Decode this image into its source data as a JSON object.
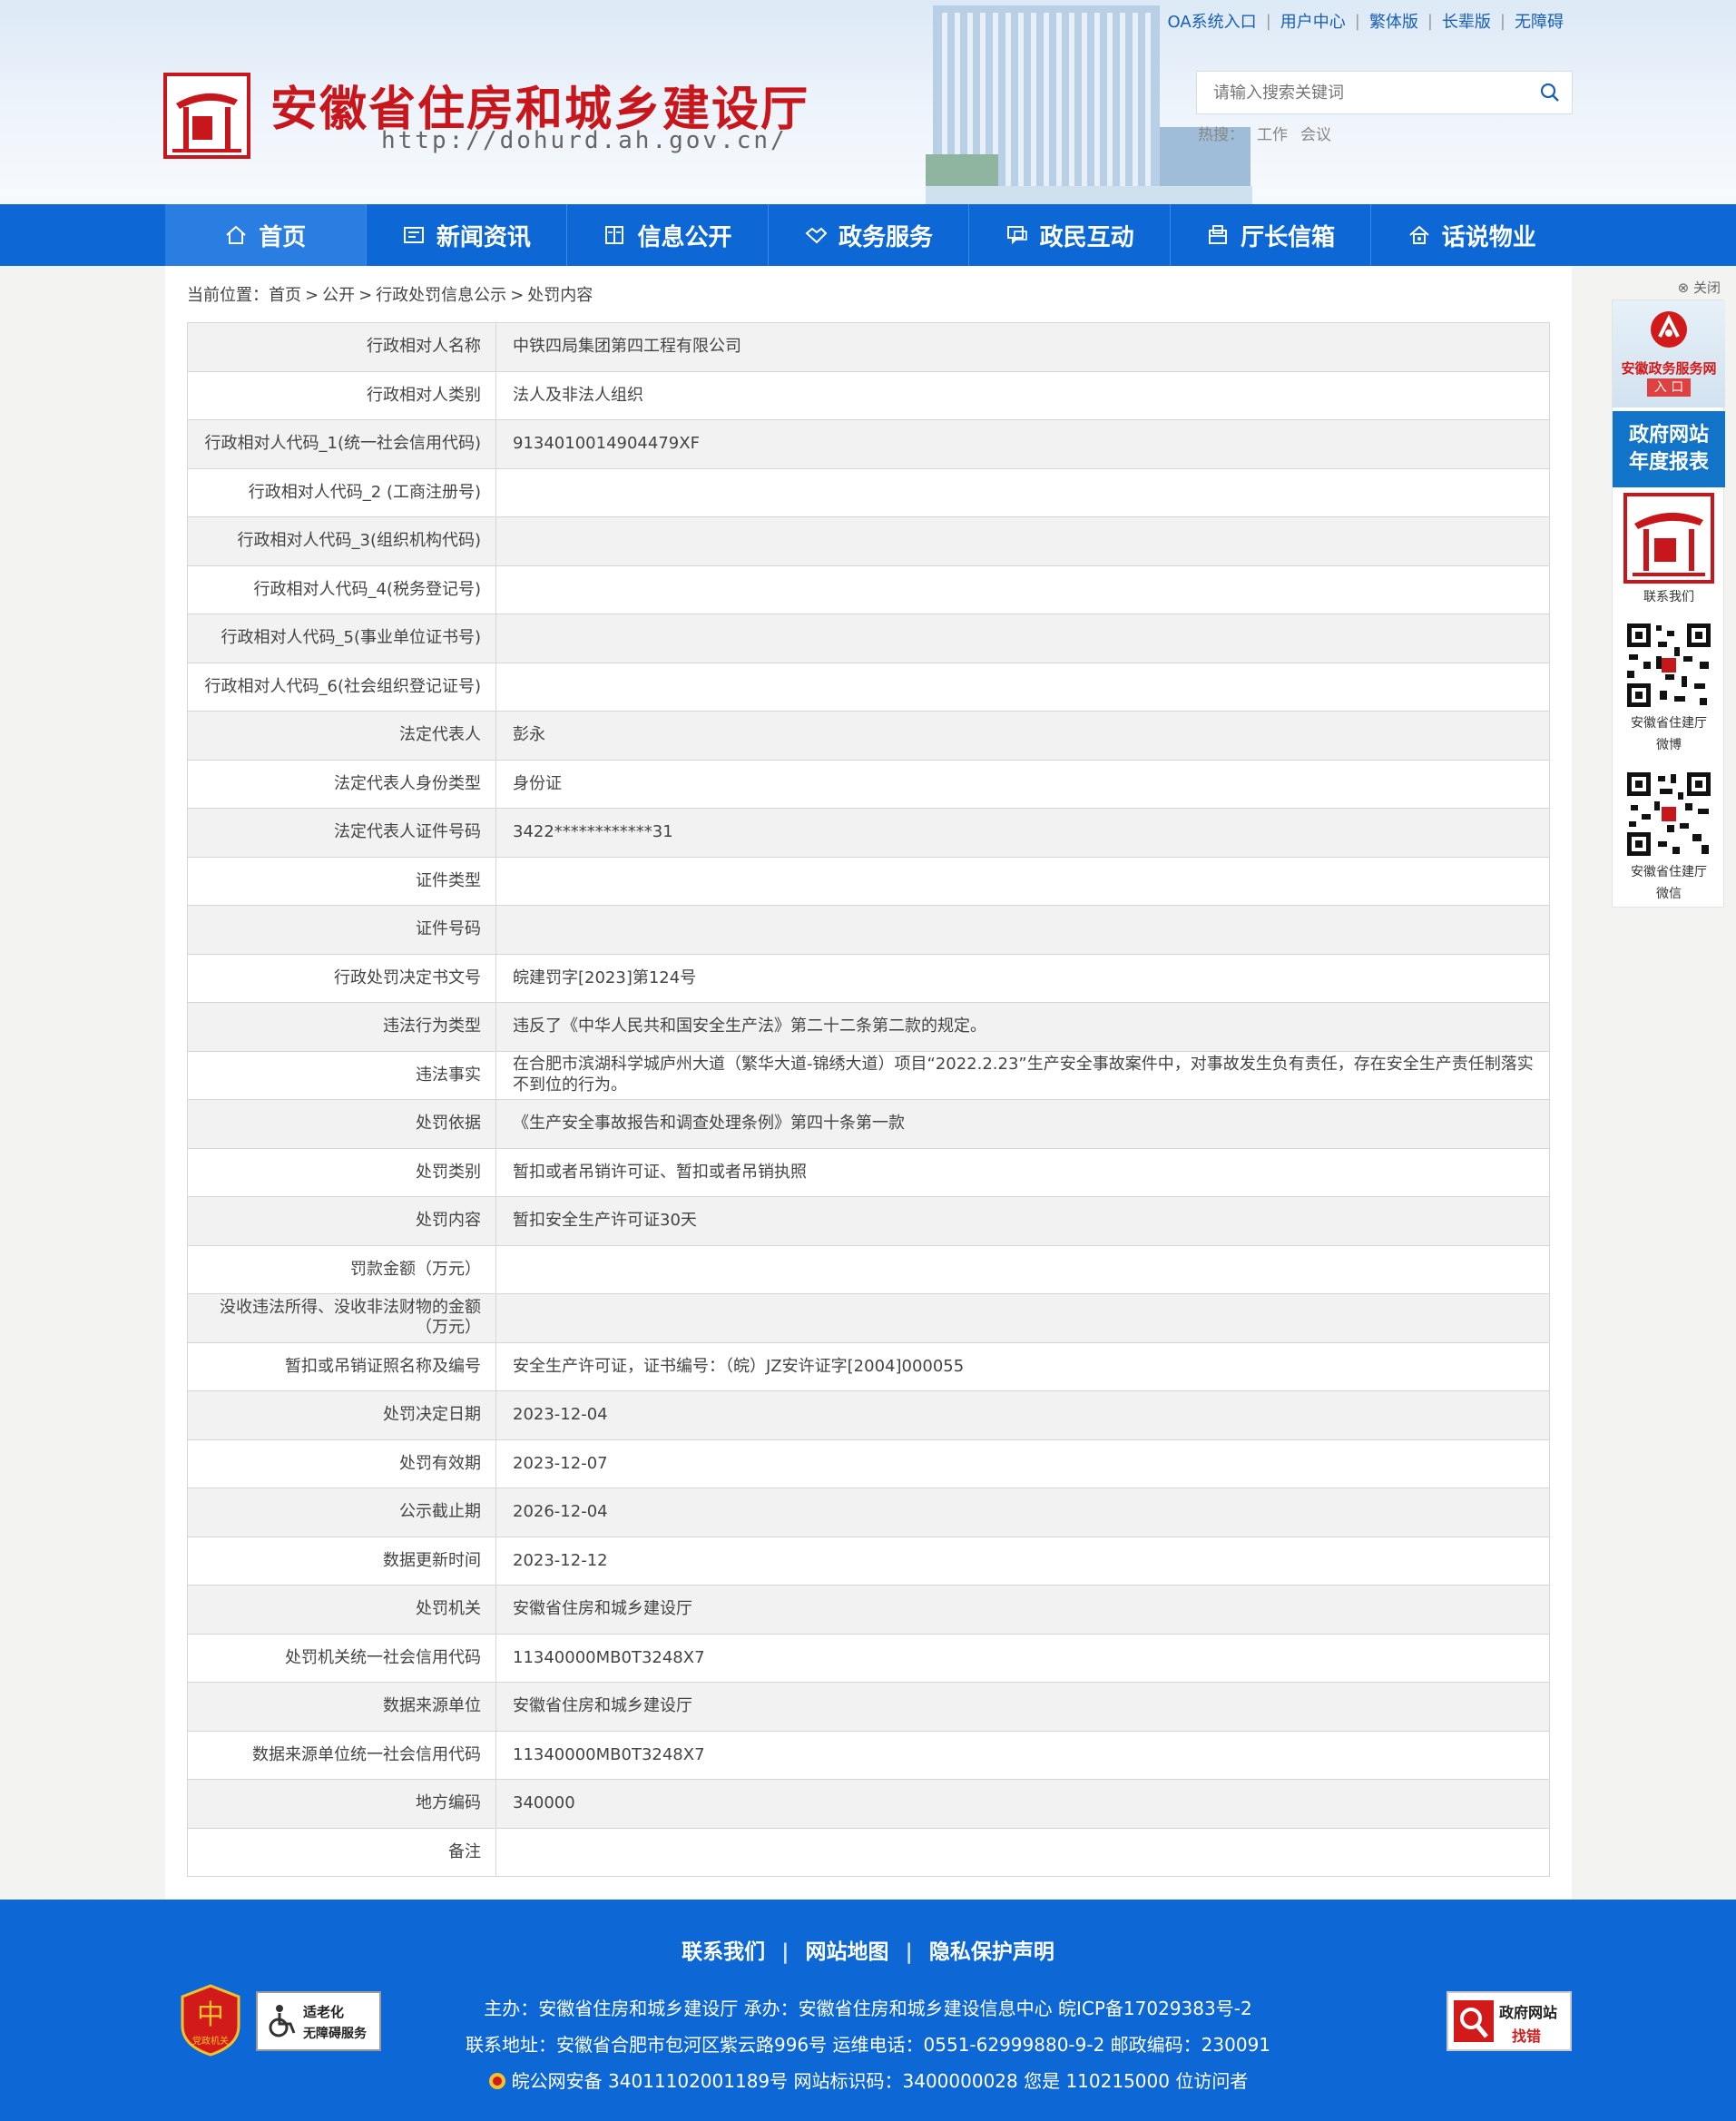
{
  "header": {
    "top_links": [
      "OA系统入口",
      "用户中心",
      "繁体版",
      "长辈版",
      "无障碍"
    ],
    "site_title": "安徽省住房和城乡建设厅",
    "site_url": "http://dohurd.ah.gov.cn/",
    "search_placeholder": "请输入搜索关键词",
    "hot_label": "热搜：",
    "hot_words": [
      "工作",
      "会议"
    ]
  },
  "nav": {
    "items": [
      {
        "label": "首页",
        "icon": "home-icon"
      },
      {
        "label": "新闻资讯",
        "icon": "news-icon"
      },
      {
        "label": "信息公开",
        "icon": "book-icon"
      },
      {
        "label": "政务服务",
        "icon": "handshake-icon"
      },
      {
        "label": "政民互动",
        "icon": "chat-icon"
      },
      {
        "label": "厅长信箱",
        "icon": "mailbox-icon"
      },
      {
        "label": "话说物业",
        "icon": "house-icon"
      }
    ]
  },
  "breadcrumb": {
    "prefix": "当前位置：",
    "items": [
      "首页",
      "公开",
      "行政处罚信息公示",
      "处罚内容"
    ],
    "sep": ">"
  },
  "table": {
    "rows": [
      {
        "k": "行政相对人名称",
        "v": "中铁四局集团第四工程有限公司"
      },
      {
        "k": "行政相对人类别",
        "v": "法人及非法人组织"
      },
      {
        "k": "行政相对人代码_1(统一社会信用代码)",
        "v": "9134010014904479XF"
      },
      {
        "k": "行政相对人代码_2 (工商注册号)",
        "v": ""
      },
      {
        "k": "行政相对人代码_3(组织机构代码)",
        "v": ""
      },
      {
        "k": "行政相对人代码_4(税务登记号)",
        "v": ""
      },
      {
        "k": "行政相对人代码_5(事业单位证书号)",
        "v": ""
      },
      {
        "k": "行政相对人代码_6(社会组织登记证号)",
        "v": ""
      },
      {
        "k": "法定代表人",
        "v": "彭永"
      },
      {
        "k": "法定代表人身份类型",
        "v": "身份证"
      },
      {
        "k": "法定代表人证件号码",
        "v": "3422************31"
      },
      {
        "k": "证件类型",
        "v": ""
      },
      {
        "k": "证件号码",
        "v": ""
      },
      {
        "k": "行政处罚决定书文号",
        "v": "皖建罚字[2023]第124号"
      },
      {
        "k": "违法行为类型",
        "v": "违反了《中华人民共和国安全生产法》第二十二条第二款的规定。"
      },
      {
        "k": "违法事实",
        "v": "在合肥市滨湖科学城庐州大道（繁华大道-锦绣大道）项目“2022.2.23”生产安全事故案件中，对事故发生负有责任，存在安全生产责任制落实不到位的行为。"
      },
      {
        "k": "处罚依据",
        "v": "《生产安全事故报告和调查处理条例》第四十条第一款"
      },
      {
        "k": "处罚类别",
        "v": "暂扣或者吊销许可证、暂扣或者吊销执照"
      },
      {
        "k": "处罚内容",
        "v": "暂扣安全生产许可证30天"
      },
      {
        "k": "罚款金额（万元）",
        "v": ""
      },
      {
        "k": "没收违法所得、没收非法财物的金额（万元）",
        "v": ""
      },
      {
        "k": "暂扣或吊销证照名称及编号",
        "v": "安全生产许可证，证书编号：（皖）JZ安许证字[2004]000055"
      },
      {
        "k": "处罚决定日期",
        "v": "2023-12-04"
      },
      {
        "k": "处罚有效期",
        "v": "2023-12-07"
      },
      {
        "k": "公示截止期",
        "v": "2026-12-04"
      },
      {
        "k": "数据更新时间",
        "v": "2023-12-12"
      },
      {
        "k": "处罚机关",
        "v": "安徽省住房和城乡建设厅"
      },
      {
        "k": "处罚机关统一社会信用代码",
        "v": "11340000MB0T3248X7"
      },
      {
        "k": "数据来源单位",
        "v": "安徽省住房和城乡建设厅"
      },
      {
        "k": "数据来源单位统一社会信用代码",
        "v": "11340000MB0T3248X7"
      },
      {
        "k": "地方编码",
        "v": "340000"
      },
      {
        "k": "备注",
        "v": ""
      }
    ]
  },
  "float": {
    "close": "⊗ 关闭",
    "zwfw_label": "安徽政务服务网",
    "zwfw_entry": "入 口",
    "report_line1": "政府网站",
    "report_line2": "年度报表",
    "contact": "联系我们",
    "weibo_line1": "安徽省住建厅",
    "weibo_line2": "微博",
    "wechat_line1": "安徽省住建厅",
    "wechat_line2": "微信"
  },
  "footer": {
    "links": [
      "联系我们",
      "网站地图",
      "隐私保护声明"
    ],
    "line1": "主办：安徽省住房和城乡建设厅    承办：安徽省住房和城乡建设信息中心    皖ICP备17029383号-2",
    "line2": "联系地址：安徽省合肥市包河区紫云路996号    运维电话：0551-62999880-9-2    邮政编码：230091",
    "line3": "皖公网安备 34011102001189号    网站标识码：3400000028    您是 110215000 位访问者",
    "badge_old_1": "适老化",
    "badge_old_2": "无障碍服务",
    "badge_find_1": "政府网站",
    "badge_find_2": "找错",
    "badge_dang": "党政机关"
  },
  "colors": {
    "brand_blue": "#0d68d6",
    "title_red": "#c8161d"
  }
}
